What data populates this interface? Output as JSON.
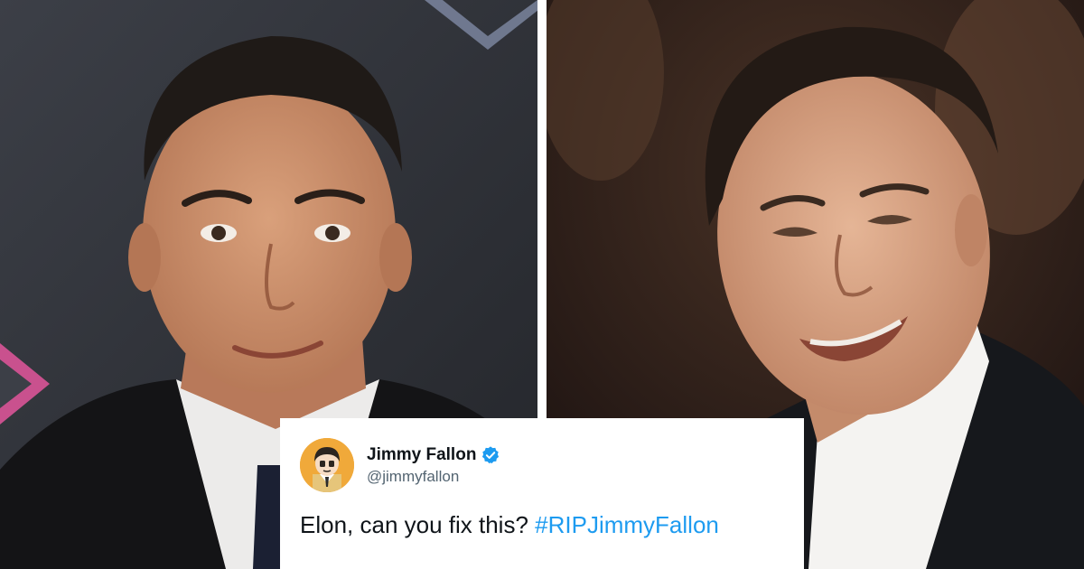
{
  "photos": {
    "left": {
      "subject": "photo-left-man"
    },
    "right": {
      "subject": "photo-right-man"
    }
  },
  "tweet": {
    "display_name": "Jimmy Fallon",
    "handle": "@jimmyfallon",
    "text": "Elon, can you fix this?",
    "hashtag": "#RIPJimmyFallon",
    "verified_icon": "verified-badge-icon",
    "colors": {
      "link": "#1d9bf0",
      "text": "#0f1419",
      "muted": "#536471",
      "verified": "#1d9bf0"
    }
  }
}
